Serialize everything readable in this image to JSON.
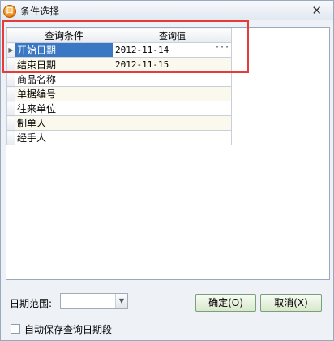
{
  "window": {
    "title": "条件选择",
    "close_glyph": "✕",
    "app_icon_letter": "口"
  },
  "grid": {
    "columns": [
      "查询条件",
      "查询值"
    ],
    "rows": [
      {
        "cond": "开始日期",
        "value": "2012-11-14",
        "selected": true
      },
      {
        "cond": "结束日期",
        "value": "2012-11-15"
      },
      {
        "cond": "商品名称",
        "value": ""
      },
      {
        "cond": "单据编号",
        "value": ""
      },
      {
        "cond": "往来单位",
        "value": ""
      },
      {
        "cond": "制单人",
        "value": ""
      },
      {
        "cond": "经手人",
        "value": ""
      }
    ],
    "row_indicator": "▶",
    "ellipsis": "···"
  },
  "footer": {
    "date_range_label": "日期范围:",
    "date_range_value": "",
    "dropdown_glyph": "▼",
    "ok_label": "确定(O)",
    "cancel_label": "取消(X)",
    "autosave_label": "自动保存查询日期段",
    "autosave_checked": false
  },
  "colors": {
    "selection": "#3b78c4",
    "highlight_box": "#e53b3b",
    "button_border": "#7aa07a"
  }
}
